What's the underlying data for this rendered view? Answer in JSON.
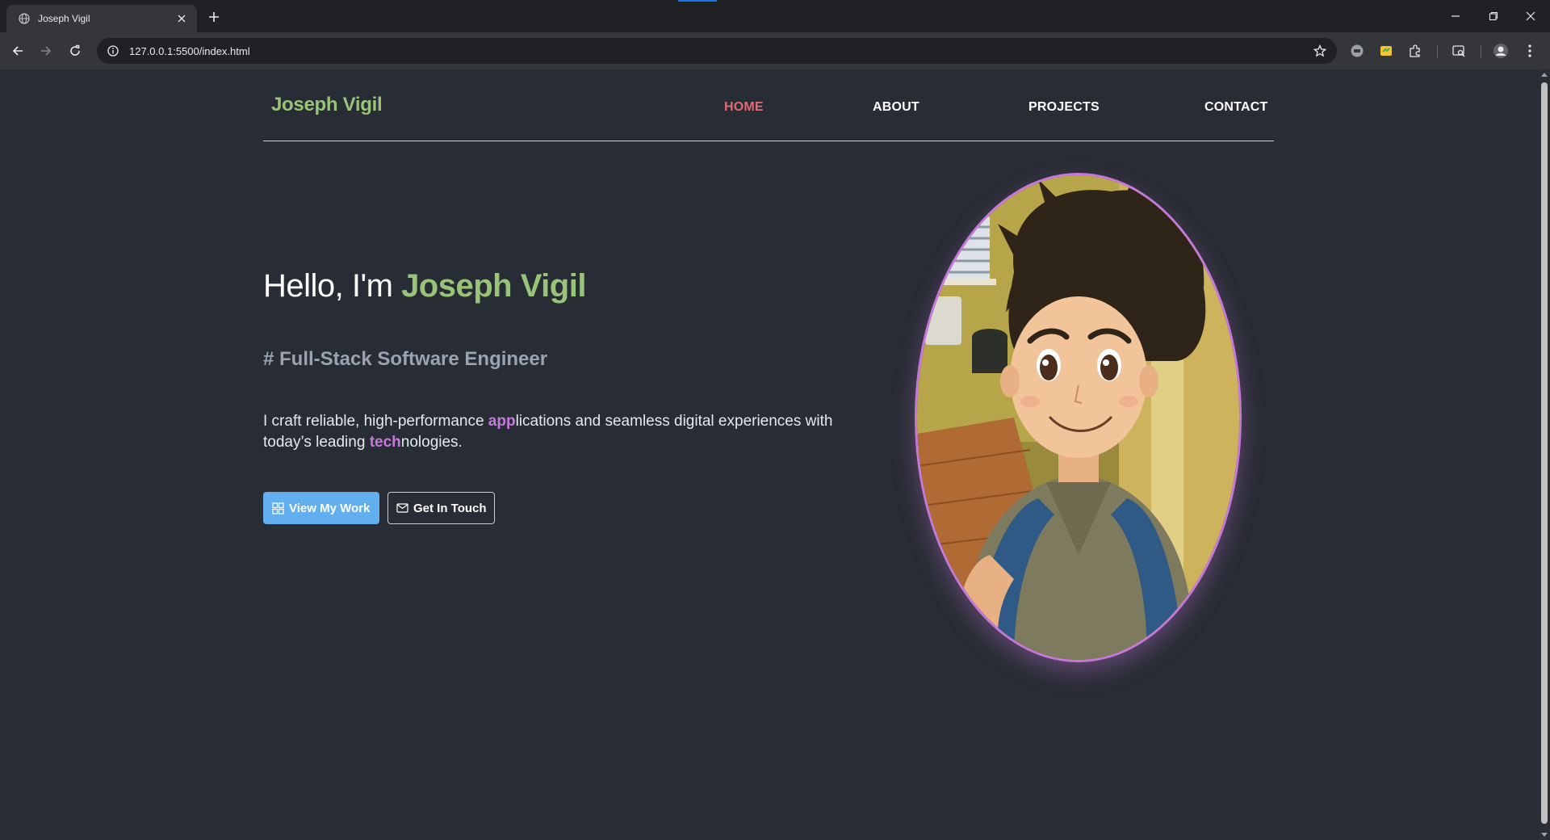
{
  "browser": {
    "tab_title": "Joseph Vigil",
    "url": "127.0.0.1:5500/index.html"
  },
  "site": {
    "logo": "Joseph Vigil",
    "nav": {
      "home": "HOME",
      "about": "ABOUT",
      "projects": "PROJECTS",
      "contact": "CONTACT"
    },
    "hero": {
      "greeting": "Hello, I'm ",
      "name": "Joseph Vigil",
      "subtitle": "# Full-Stack Software Engineer",
      "desc_part1": "I craft reliable, high-performance ",
      "desc_hl1": "app",
      "desc_part2": "lications and seamless digital experiences with today’s leading ",
      "desc_hl2": "tech",
      "desc_part3": "nologies.",
      "btn_work": "View My Work",
      "btn_contact": "Get In Touch"
    }
  },
  "colors": {
    "page_bg": "#282c34",
    "green_accent": "#98c379",
    "purple_accent": "#c678dd",
    "active_nav": "#e06c75",
    "primary_button": "#61afef"
  },
  "icons": {
    "tab_favicon": "globe-icon",
    "btn_work_icon": "grid-icon",
    "btn_contact_icon": "envelope-icon"
  }
}
